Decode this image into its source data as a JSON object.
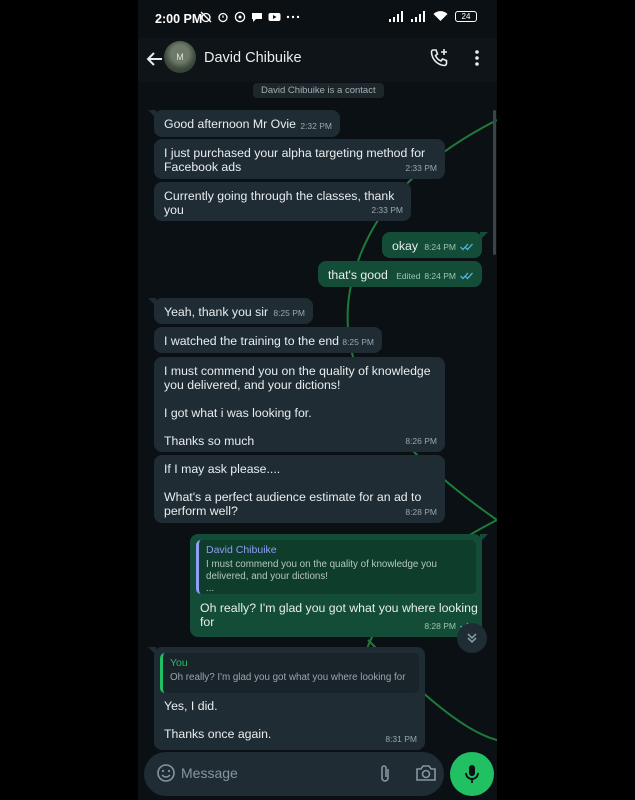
{
  "status_bar": {
    "time": "2:00 PM",
    "battery": "24"
  },
  "header": {
    "contact_name": "David Chibuike",
    "avatar_letter": "M"
  },
  "system_note": "David Chibuike is a contact",
  "messages": [
    {
      "text": "Good afternoon Mr Ovie",
      "time": "2:32 PM"
    },
    {
      "text": "I just purchased your alpha targeting method for\nFacebook ads",
      "time": "2:33 PM"
    },
    {
      "text": "Currently going through the classes, thank you",
      "time": "2:33 PM"
    },
    {
      "text": "okay",
      "time": "8:24 PM"
    },
    {
      "text": "that's good",
      "time": "8:24 PM",
      "edited": "Edited"
    },
    {
      "text": "Yeah, thank you sir",
      "time": "8:25 PM"
    },
    {
      "text": "I watched the training to the end",
      "time": "8:25 PM"
    },
    {
      "text": "I must commend you on the quality of knowledge\nyou delivered, and your dictions!\n\nI got what i was looking for.\n\nThanks so much",
      "time": "8:26 PM"
    },
    {
      "text": "If I may ask please....\n\nWhat's a perfect audience estimate for an ad to\nperform well?",
      "time": "8:28 PM"
    },
    {
      "quote_name": "David Chibuike",
      "quote_text": "I must commend you on the quality of knowledge you\ndelivered, and your dictions!\n...",
      "text": "Oh really? I'm glad you got what you where looking\nfor",
      "time": "8:28 PM"
    },
    {
      "quote_name": "You",
      "quote_text": "Oh really? I'm glad you got what you where looking for",
      "text": "Yes, I did.\n\nThanks once again.",
      "time": "8:31 PM"
    }
  ],
  "input": {
    "placeholder": "Message"
  },
  "colors": {
    "incoming": "#1f2c33",
    "outgoing": "#144d37",
    "accent": "#21c063",
    "read_tick": "#53bdeb"
  }
}
